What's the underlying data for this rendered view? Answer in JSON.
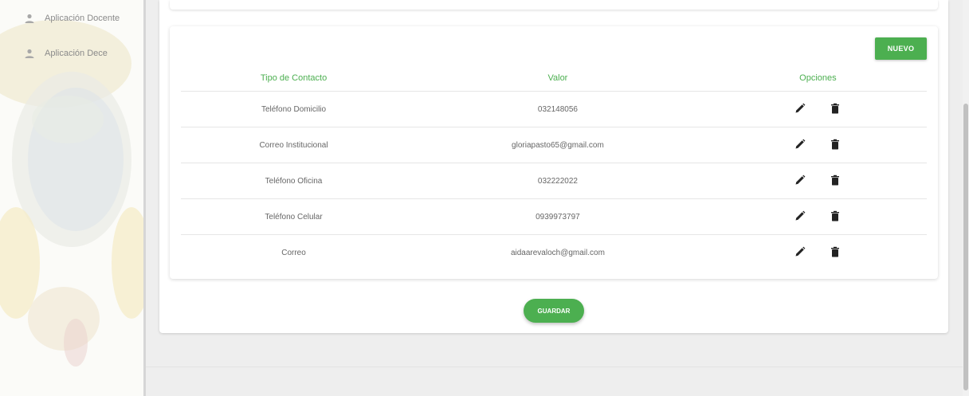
{
  "sidebar": {
    "items": [
      {
        "label": "Aplicación Docente",
        "icon": "person-icon"
      },
      {
        "label": "Aplicación Dece",
        "icon": "person-icon"
      }
    ]
  },
  "contacts": {
    "new_button_label": "NUEVO",
    "headers": {
      "type": "Tipo de Contacto",
      "value": "Valor",
      "options": "Opciones"
    },
    "rows": [
      {
        "type": "Teléfono Domicilio",
        "value": "032148056"
      },
      {
        "type": "Correo Institucional",
        "value": "gloriapasto65@gmail.com"
      },
      {
        "type": "Teléfono Oficina",
        "value": "032222022"
      },
      {
        "type": "Teléfono Celular",
        "value": "0939973797"
      },
      {
        "type": "Correo",
        "value": "aidaarevaloch@gmail.com"
      }
    ],
    "row_icons": {
      "edit": "pencil-icon",
      "delete": "trash-icon"
    }
  },
  "save_button_label": "GUARDAR",
  "colors": {
    "accent": "#4caf50",
    "background": "#eeeeee",
    "card": "#ffffff"
  }
}
